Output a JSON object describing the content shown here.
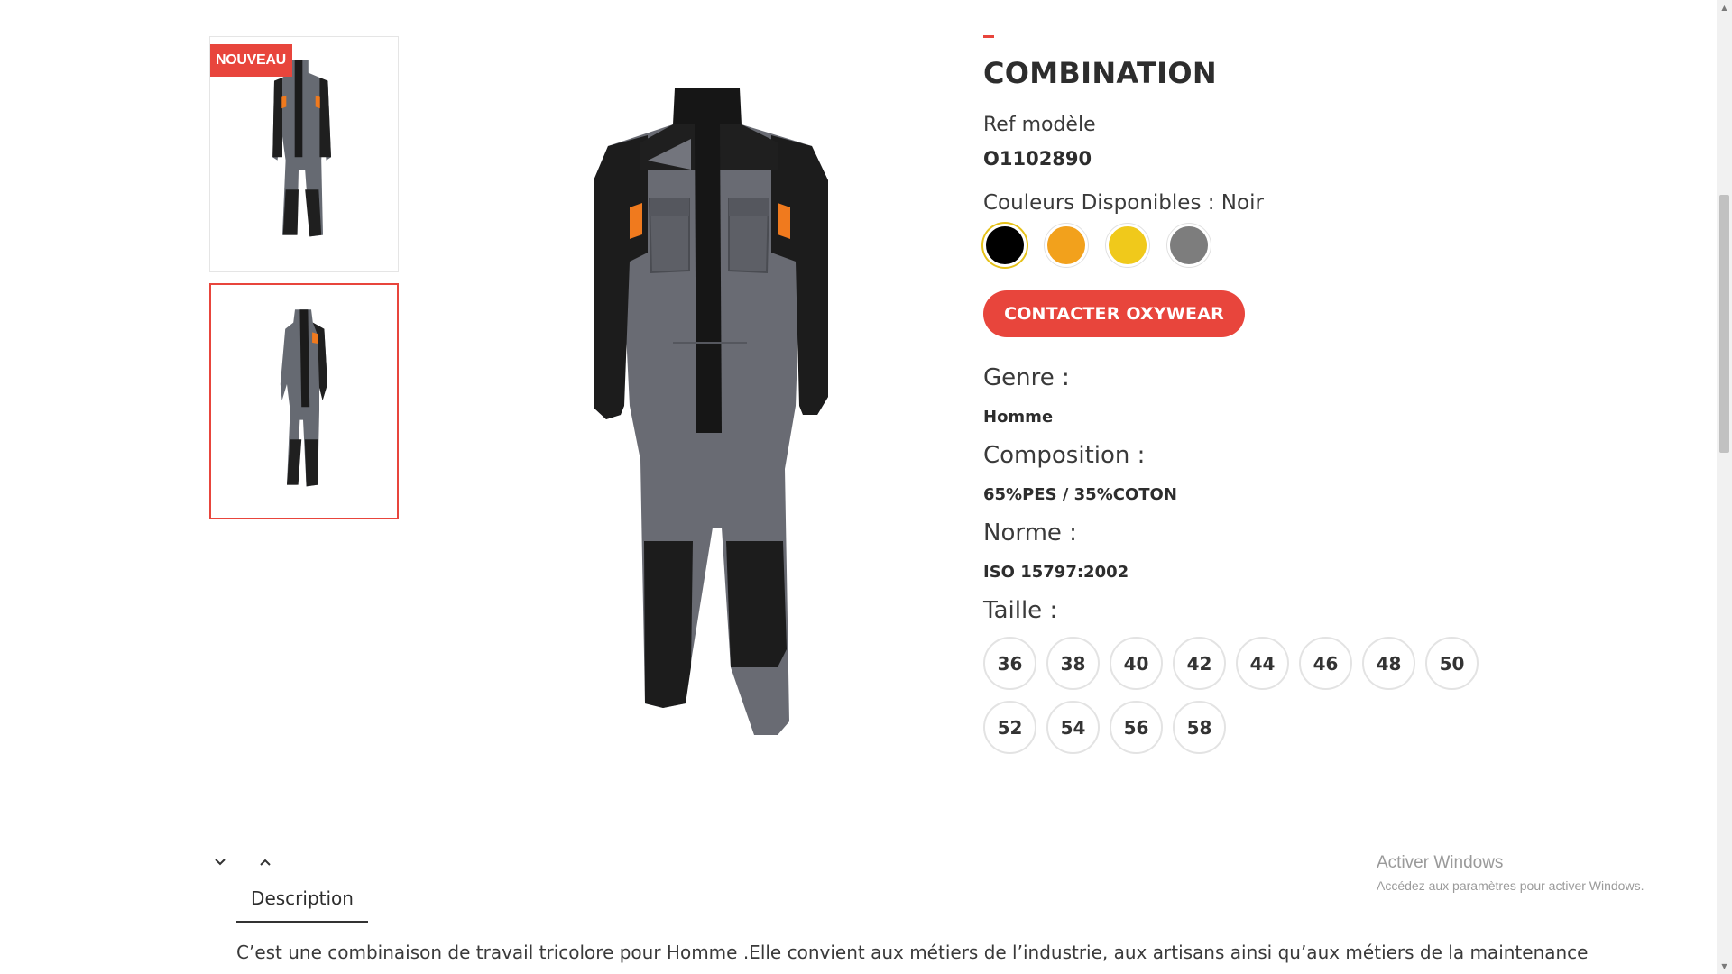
{
  "badge": {
    "new_label": "NOUVEAU"
  },
  "product": {
    "title": "COMBINATION",
    "ref_label": "Ref modèle",
    "ref_value": "O1102890",
    "colors_label": "Couleurs Disponibles : Noir",
    "swatches": [
      {
        "name": "Noir",
        "color": "#000000"
      },
      {
        "name": "Orange",
        "color": "#f2a11c"
      },
      {
        "name": "Jaune",
        "color": "#f0c91b"
      },
      {
        "name": "Gris",
        "color": "#7d7d7d"
      }
    ],
    "contact_label": "CONTACTER OXYWEAR",
    "genre_label": "Genre :",
    "genre_value": "Homme",
    "composition_label": "Composition :",
    "composition_value": "65%PES / 35%COTON",
    "norme_label": "Norme :",
    "norme_value": "ISO 15797:2002",
    "taille_label": "Taille :",
    "sizes": [
      "36",
      "38",
      "40",
      "42",
      "44",
      "46",
      "48",
      "50",
      "52",
      "54",
      "56",
      "58"
    ]
  },
  "tabs": {
    "description_label": "Description"
  },
  "description": {
    "text": "C’est une combinaison de travail tricolore pour Homme .Elle convient aux métiers de l’industrie, aux artisans ainsi qu’aux métiers de la maintenance"
  },
  "windows_watermark": {
    "title": "Activer Windows",
    "subtitle": "Accédez aux paramètres pour activer Windows."
  },
  "accent_color": "#e8453c"
}
